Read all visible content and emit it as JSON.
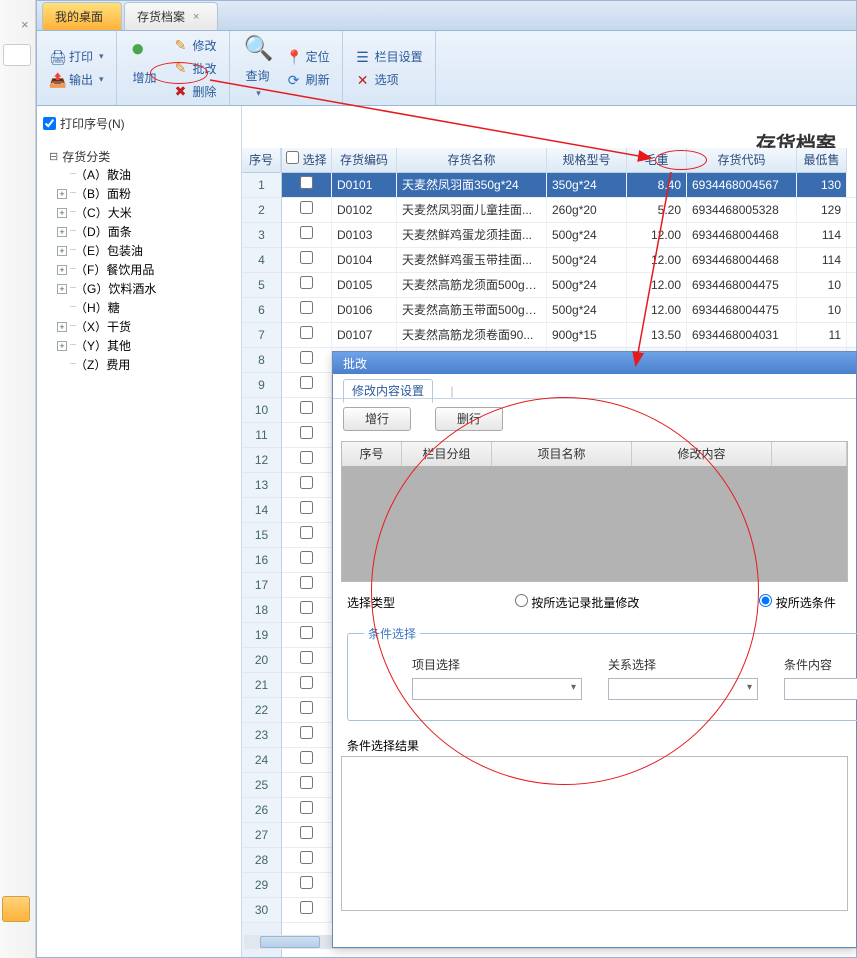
{
  "tabs": {
    "desktop": "我的桌面",
    "active": "存货档案"
  },
  "ribbon": {
    "print": "打印",
    "output": "输出",
    "add": "增加",
    "edit": "修改",
    "batch_edit": "批改",
    "delete": "删除",
    "query": "查询",
    "locate": "定位",
    "refresh": "刷新",
    "col_setting": "栏目设置",
    "options": "选项"
  },
  "subhead": {
    "print_seq": "打印序号(N)"
  },
  "page_title": "存货档案",
  "tree": {
    "root": "存货分类",
    "nodes": [
      {
        "label": "（A）散油",
        "box": ""
      },
      {
        "label": "（B）面粉",
        "box": "+"
      },
      {
        "label": "（C）大米",
        "box": "+"
      },
      {
        "label": "（D）面条",
        "box": "+"
      },
      {
        "label": "（E）包装油",
        "box": "+"
      },
      {
        "label": "（F）餐饮用品",
        "box": "+"
      },
      {
        "label": "（G）饮料酒水",
        "box": "+"
      },
      {
        "label": "（H）糖",
        "box": ""
      },
      {
        "label": "（X）干货",
        "box": "+"
      },
      {
        "label": "（Y）其他",
        "box": "+"
      },
      {
        "label": "（Z）费用",
        "box": ""
      }
    ]
  },
  "grid": {
    "headers": {
      "seq": "序号",
      "select": "选择",
      "code": "存货编码",
      "name": "存货名称",
      "spec": "规格型号",
      "gw": "毛重",
      "scode": "存货代码",
      "min": "最低售"
    },
    "rows": [
      {
        "seq": 1,
        "code": "D0101",
        "name": "天麦然凤羽面350g*24",
        "spec": "350g*24",
        "gw": "8.40",
        "scode": "6934468004567",
        "min": "130",
        "selected": true
      },
      {
        "seq": 2,
        "code": "D0102",
        "name": "天麦然凤羽面儿童挂面...",
        "spec": "260g*20",
        "gw": "5.20",
        "scode": "6934468005328",
        "min": "129"
      },
      {
        "seq": 3,
        "code": "D0103",
        "name": "天麦然鲜鸡蛋龙须挂面...",
        "spec": "500g*24",
        "gw": "12.00",
        "scode": "6934468004468",
        "min": "114"
      },
      {
        "seq": 4,
        "code": "D0104",
        "name": "天麦然鲜鸡蛋玉带挂面...",
        "spec": "500g*24",
        "gw": "12.00",
        "scode": "6934468004468",
        "min": "114"
      },
      {
        "seq": 5,
        "code": "D0105",
        "name": "天麦然高筋龙须面500g*24",
        "spec": "500g*24",
        "gw": "12.00",
        "scode": "6934468004475",
        "min": "10"
      },
      {
        "seq": 6,
        "code": "D0106",
        "name": "天麦然高筋玉带面500g*24",
        "spec": "500g*24",
        "gw": "12.00",
        "scode": "6934468004475",
        "min": "10"
      },
      {
        "seq": 7,
        "code": "D0107",
        "name": "天麦然高筋龙须卷面90...",
        "spec": "900g*15",
        "gw": "13.50",
        "scode": "6934468004031",
        "min": "11"
      }
    ],
    "empty_rows": [
      8,
      9,
      10,
      11,
      12,
      13,
      14,
      15,
      16,
      17,
      18,
      19,
      20,
      21,
      22,
      23,
      24,
      25,
      26,
      27,
      28,
      29,
      30
    ]
  },
  "dialog": {
    "title": "批改",
    "tab": "修改内容设置",
    "btn_add": "增行",
    "btn_del": "删行",
    "gh": {
      "seq": "序号",
      "group": "栏目分组",
      "item": "项目名称",
      "content": "修改内容"
    },
    "type_label": "选择类型",
    "radio1": "按所选记录批量修改",
    "radio2": "按所选条件",
    "cond_legend": "条件选择",
    "cond_item": "项目选择",
    "cond_rel": "关系选择",
    "cond_val": "条件内容",
    "res_label": "条件选择结果"
  }
}
